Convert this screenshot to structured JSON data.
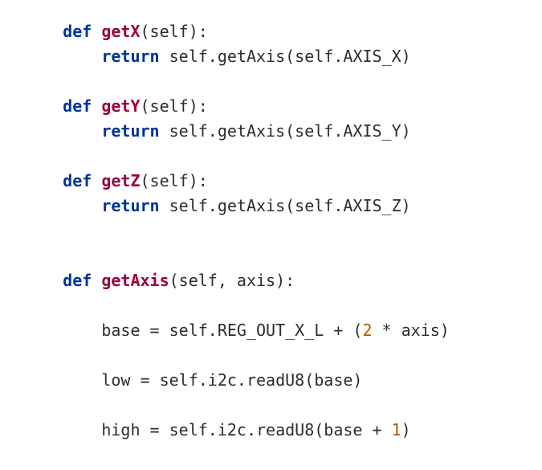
{
  "kw": {
    "def": "def",
    "return": "return"
  },
  "fn": {
    "getX": "getX",
    "getY": "getY",
    "getZ": "getZ",
    "getAxis": "getAxis"
  },
  "txt": {
    "paramsSelf": "(self):",
    "paramsSelfAxis": "(self, axis):",
    "retX": " self.getAxis(self.AXIS_X)",
    "retY": " self.getAxis(self.AXIS_Y)",
    "retZ": " self.getAxis(self.AXIS_Z)",
    "baseA": "base = self.REG_OUT_X_L + (",
    "baseB": " * axis)",
    "low": "low = self.i2c.readU8(base)",
    "highA": "high = self.i2c.readU8(base + ",
    "highB": ")"
  },
  "num": {
    "two": "2",
    "one": "1"
  },
  "indent": {
    "one": "    ",
    "two": "        "
  }
}
